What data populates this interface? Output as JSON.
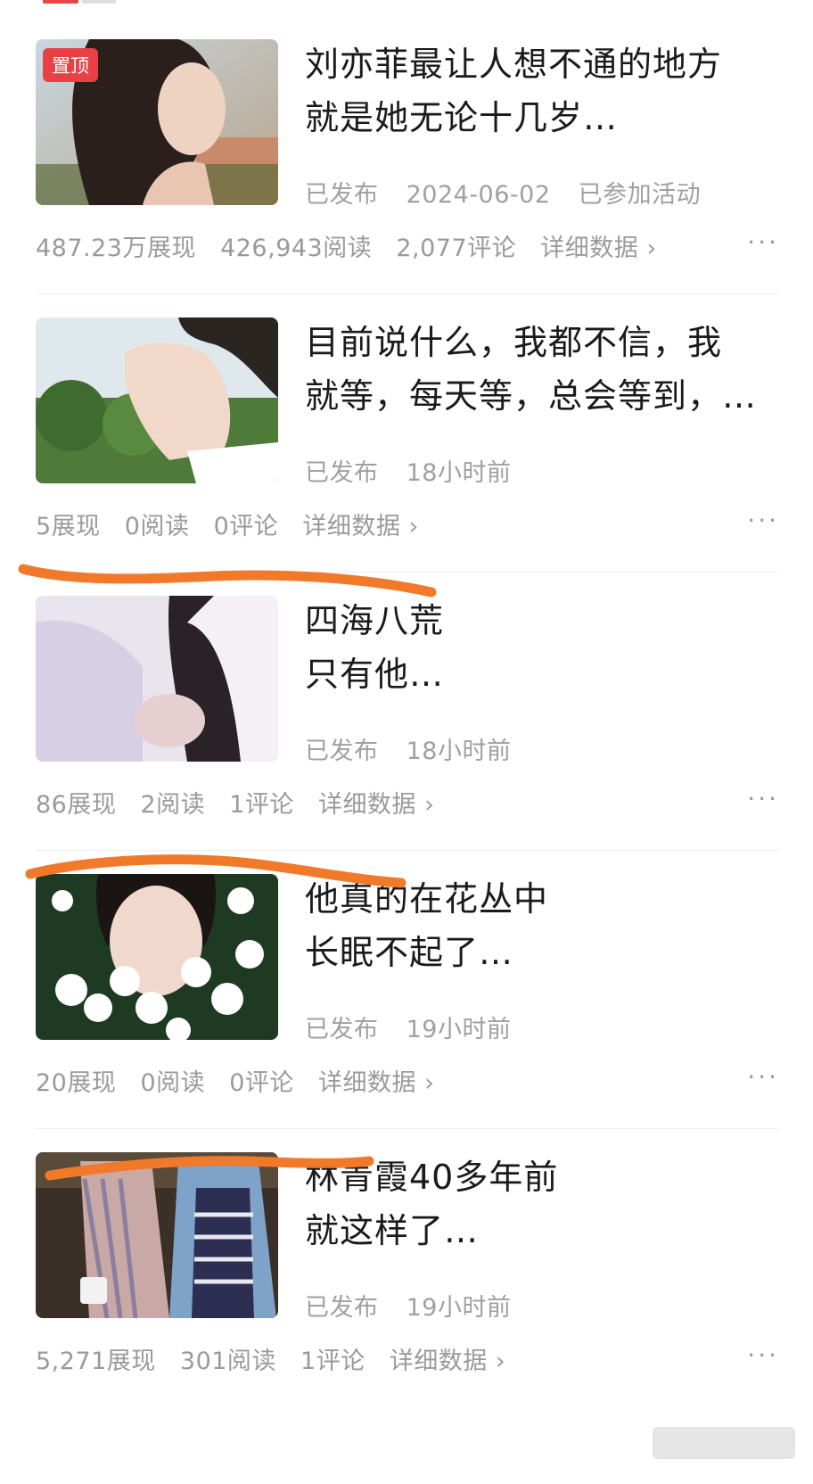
{
  "articles": [
    {
      "title_line1": "刘亦菲最让人想不通的地方",
      "title_line2": "就是她无论十几岁…",
      "pinned_label": "置顶",
      "status": "已发布",
      "time": "2024-06-02",
      "extra": "已参加活动",
      "impressions": "487.23万展现",
      "reads": "426,943阅读",
      "comments": "2,077评论",
      "detail_label": "详细数据",
      "more_label": "···"
    },
    {
      "title_line1": "目前说什么，我都不信，我",
      "title_line2": "就等，每天等，总会等到，…",
      "status": "已发布",
      "time": "18小时前",
      "impressions": "5展现",
      "reads": "0阅读",
      "comments": "0评论",
      "detail_label": "详细数据",
      "more_label": "···"
    },
    {
      "title_line1": "四海八荒",
      "title_line2": "只有他…",
      "status": "已发布",
      "time": "18小时前",
      "impressions": "86展现",
      "reads": "2阅读",
      "comments": "1评论",
      "detail_label": "详细数据",
      "more_label": "···"
    },
    {
      "title_line1": "他真的在花丛中",
      "title_line2": "长眠不起了…",
      "status": "已发布",
      "time": "19小时前",
      "impressions": "20展现",
      "reads": "0阅读",
      "comments": "0评论",
      "detail_label": "详细数据",
      "more_label": "···"
    },
    {
      "title_line1": "林青霞40多年前",
      "title_line2": "就这样了…",
      "status": "已发布",
      "time": "19小时前",
      "impressions": "5,271展现",
      "reads": "301阅读",
      "comments": "1评论",
      "detail_label": "详细数据",
      "more_label": "···"
    }
  ],
  "colors": {
    "annotation": "#f07a2a",
    "pin_badge": "#e84045",
    "meta_text": "#a0a0a0"
  },
  "icons": {
    "chevron": "chevron-right-icon",
    "more": "more-dots-icon"
  }
}
